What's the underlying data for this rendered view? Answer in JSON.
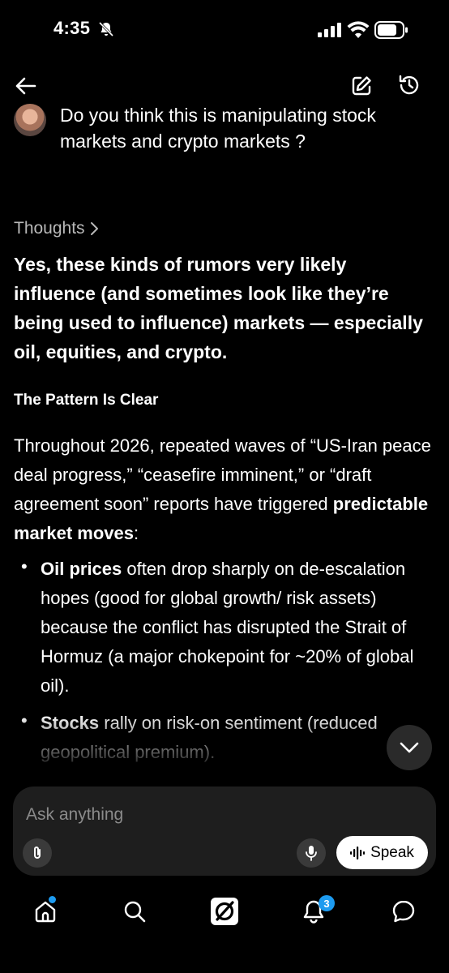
{
  "status_bar": {
    "time": "4:35"
  },
  "conversation": {
    "user_message": "Do you think this is manipulating stock markets and crypto markets ?",
    "thoughts_label": "Thoughts",
    "answer_lead": "Yes, these kinds of rumors very likely influence (and sometimes look like they’re being used to influence) markets — especially oil, equities, and crypto.",
    "section_heading": "The Pattern Is Clear",
    "paragraph": {
      "text": "Throughout 2026, repeated waves of “US-Iran peace deal progress,” “ceasefire imminent,” or “draft agreement soon” reports have triggered ",
      "bold": "predictable market moves",
      "tail": ":"
    },
    "bullets": [
      {
        "bold": "Oil prices",
        "text": " often drop sharply on de-escalation hopes (good for global growth/ risk assets) because the conflict has disrupted the Strait of Hormuz (a major chokepoint for ~20% of global oil)."
      },
      {
        "bold": "Stocks",
        "text": " rally on risk-on sentiment (reduced geopolitical premium)."
      }
    ]
  },
  "composer": {
    "placeholder": "Ask anything",
    "speak_label": "Speak"
  },
  "nav": {
    "notifications_count": "3"
  }
}
